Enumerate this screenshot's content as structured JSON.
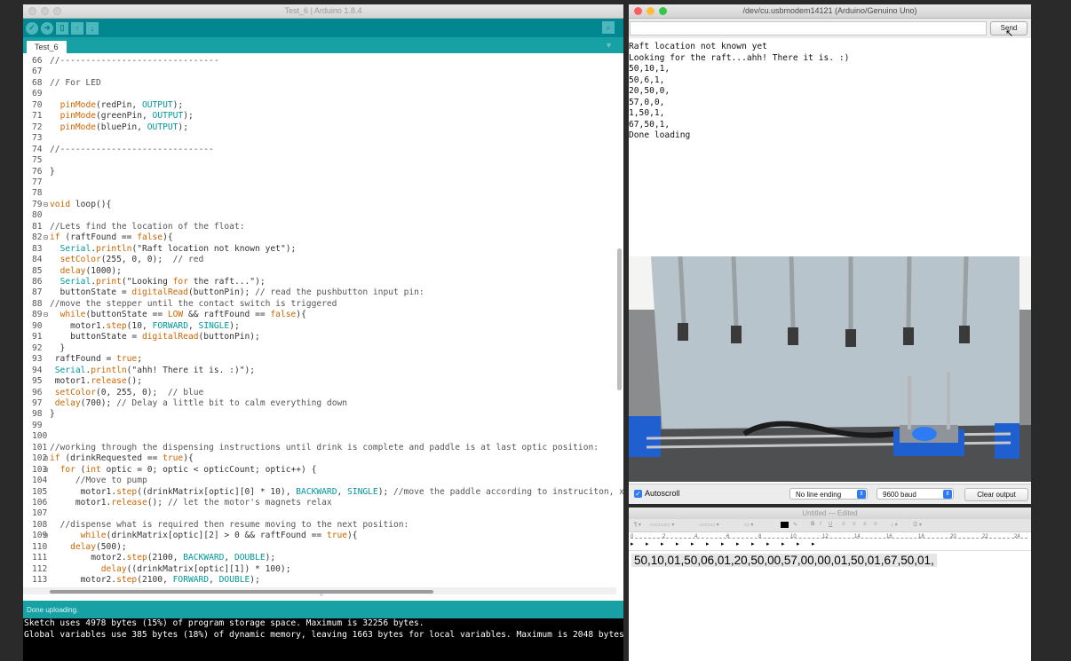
{
  "ide": {
    "title": "Test_6 | Arduino 1.8.4",
    "tab": "Test_6",
    "status": "Done uploading.",
    "console": [
      "Sketch uses 4978 bytes (15%) of program storage space. Maximum is 32256 bytes.",
      "Global variables use 385 bytes (18%) of dynamic memory, leaving 1663 bytes for local variables. Maximum is 2048 bytes."
    ],
    "code": [
      {
        "n": "66",
        "t": "//-------------------------------"
      },
      {
        "n": "67",
        "t": ""
      },
      {
        "n": "68",
        "t": "// For LED"
      },
      {
        "n": "69",
        "t": ""
      },
      {
        "n": "70",
        "t": "  pinMode(redPin, OUTPUT);"
      },
      {
        "n": "71",
        "t": "  pinMode(greenPin, OUTPUT);"
      },
      {
        "n": "72",
        "t": "  pinMode(bluePin, OUTPUT);"
      },
      {
        "n": "73",
        "t": ""
      },
      {
        "n": "74",
        "t": "//------------------------------"
      },
      {
        "n": "75",
        "t": ""
      },
      {
        "n": "76",
        "t": "}"
      },
      {
        "n": "77",
        "t": ""
      },
      {
        "n": "78",
        "t": ""
      },
      {
        "n": "79",
        "t": "void loop(){",
        "f": true
      },
      {
        "n": "80",
        "t": ""
      },
      {
        "n": "81",
        "t": "//Lets find the location of the float:"
      },
      {
        "n": "82",
        "t": "if (raftFound == false){",
        "f": true
      },
      {
        "n": "83",
        "t": "  Serial.println(\"Raft location not known yet\");"
      },
      {
        "n": "84",
        "t": "  setColor(255, 0, 0);  // red"
      },
      {
        "n": "85",
        "t": "  delay(1000);"
      },
      {
        "n": "86",
        "t": "  Serial.print(\"Looking for the raft...\");"
      },
      {
        "n": "87",
        "t": "  buttonState = digitalRead(buttonPin); // read the pushbutton input pin:"
      },
      {
        "n": "88",
        "t": "//move the stepper until the contact switch is triggered"
      },
      {
        "n": "89",
        "t": "  while(buttonState == LOW && raftFound == false){",
        "f": true
      },
      {
        "n": "90",
        "t": "    motor1.step(10, FORWARD, SINGLE);"
      },
      {
        "n": "91",
        "t": "    buttonState = digitalRead(buttonPin);"
      },
      {
        "n": "92",
        "t": "  }"
      },
      {
        "n": "93",
        "t": " raftFound = true;"
      },
      {
        "n": "94",
        "t": " Serial.println(\"ahh! There it is. :)\");"
      },
      {
        "n": "95",
        "t": " motor1.release();"
      },
      {
        "n": "96",
        "t": " setColor(0, 255, 0);  // blue"
      },
      {
        "n": "97",
        "t": " delay(700); // Delay a little bit to calm everything down"
      },
      {
        "n": "98",
        "t": "}"
      },
      {
        "n": "99",
        "t": ""
      },
      {
        "n": "100",
        "t": ""
      },
      {
        "n": "101",
        "t": "//working through the dispensing instructions until drink is complete and paddle is at last optic position:"
      },
      {
        "n": "102",
        "t": "if (drinkRequested == true){",
        "f": true
      },
      {
        "n": "103",
        "t": "  for (int optic = 0; optic < opticCount; optic++) {",
        "f": true
      },
      {
        "n": "104",
        "t": "     //Move to pump"
      },
      {
        "n": "105",
        "t": "      motor1.step((drinkMatrix[optic][0] * 10), BACKWARD, SINGLE); //move the paddle according to instruciton, x10"
      },
      {
        "n": "106",
        "t": "     motor1.release(); // let the motor's magnets relax"
      },
      {
        "n": "107",
        "t": ""
      },
      {
        "n": "108",
        "t": "  //dispense what is required then resume moving to the next position:"
      },
      {
        "n": "109",
        "t": "      while(drinkMatrix[optic][2] > 0 && raftFound == true){",
        "f": true
      },
      {
        "n": "110",
        "t": "    delay(500);"
      },
      {
        "n": "111",
        "t": "        motor2.step(2100, BACKWARD, DOUBLE);"
      },
      {
        "n": "112",
        "t": "          delay((drinkMatrix[optic][1]) * 100);"
      },
      {
        "n": "113",
        "t": "      motor2.step(2100, FORWARD, DOUBLE);"
      }
    ]
  },
  "serial": {
    "title": "/dev/cu.usbmodem14121 (Arduino/Genuino Uno)",
    "send_label": "Send",
    "input_value": "",
    "output": [
      "Raft location not known yet",
      "Looking for the raft...ahh! There it is. :)",
      "50,10,1,",
      "50,6,1,",
      "20,50,0,",
      "57,0,0,",
      "1,50,1,",
      "67,50,1,",
      "Done loading"
    ],
    "autoscroll_label": "Autoscroll",
    "autoscroll_checked": true,
    "line_ending": "No line ending",
    "baud": "9600 baud",
    "clear_label": "Clear output"
  },
  "textedit": {
    "title": "Untitled — Edited",
    "content": "50,10,01,50,06,01,20,50,00,57,00,00,01,50,01,67,50,01,",
    "ruler_ticks": [
      "0",
      "2",
      "4",
      "6",
      "8",
      "10",
      "12",
      "14",
      "16",
      "18",
      "20",
      "22",
      "24"
    ]
  },
  "colors": {
    "arduino_teal": "#00878f",
    "arduino_tab": "#17a1a5",
    "keyword_orange": "#cc6600",
    "console_bg": "#000000"
  }
}
